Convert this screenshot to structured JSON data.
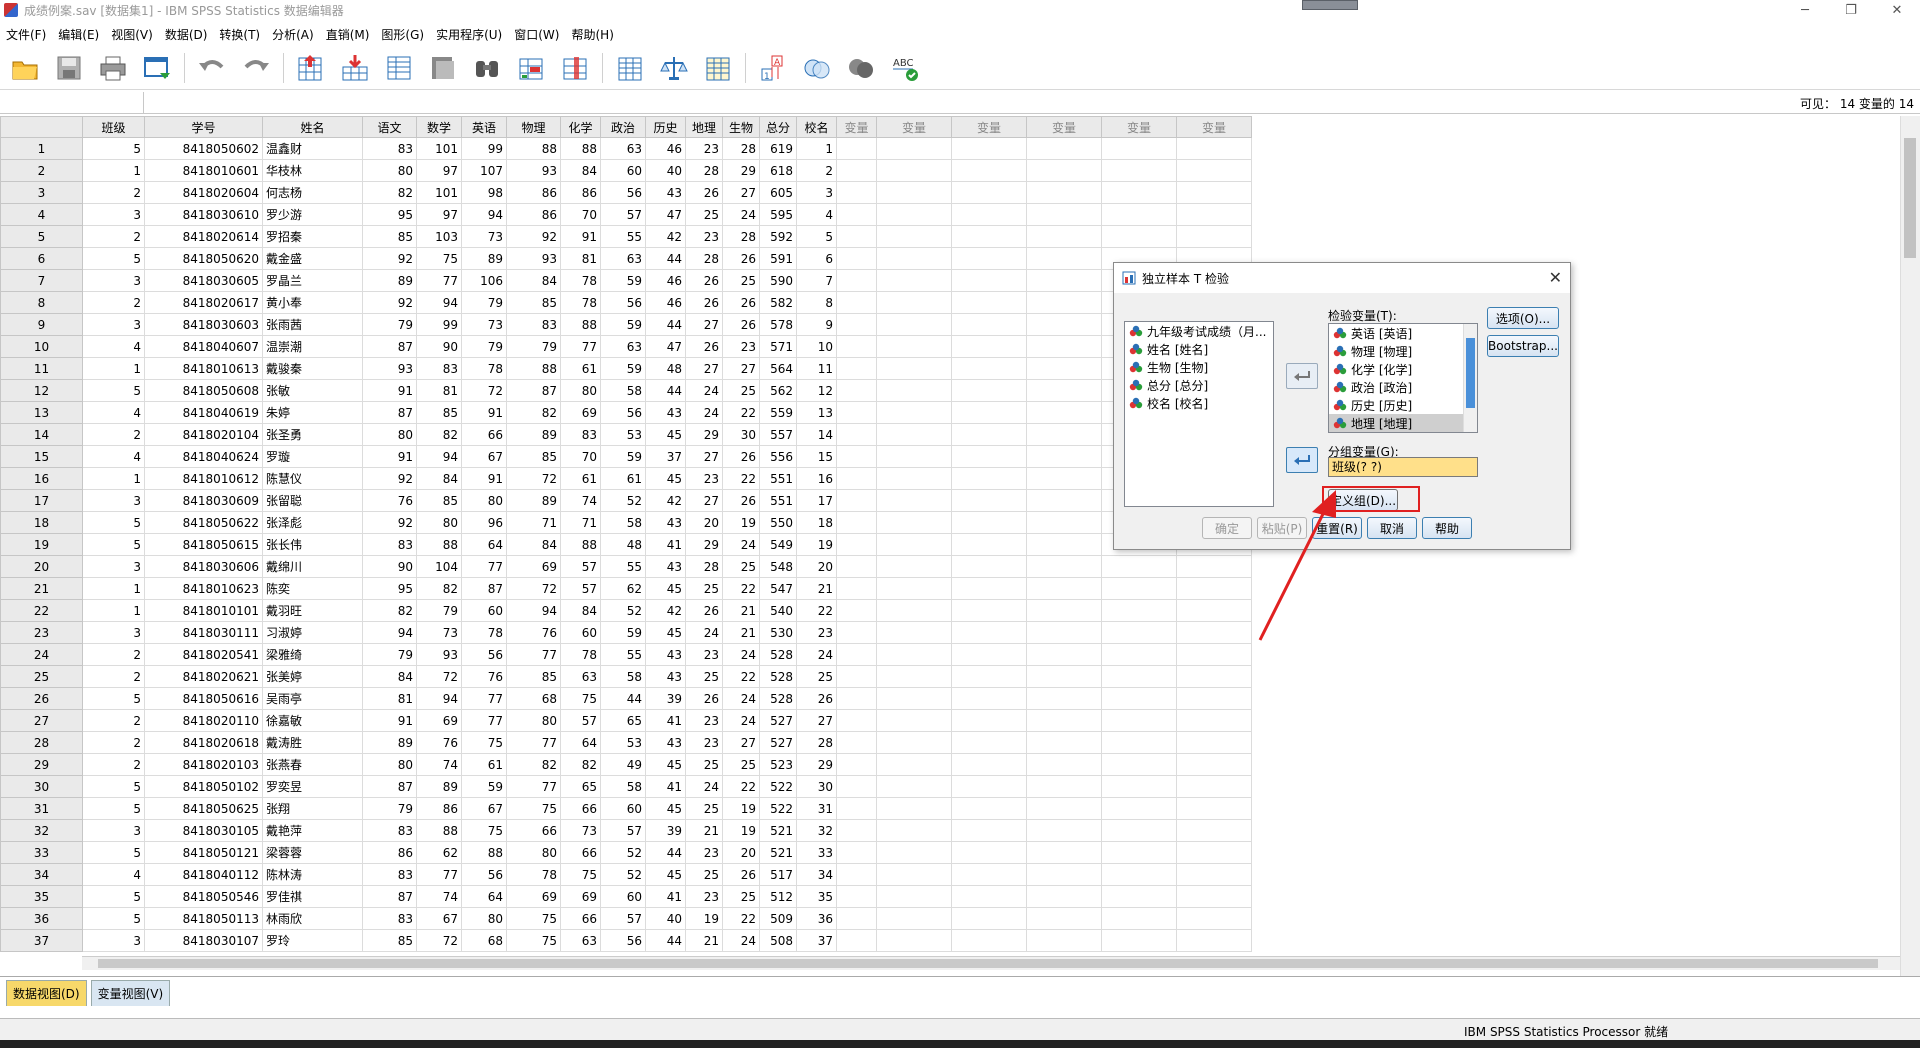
{
  "window": {
    "title": "成绩例案.sav [数据集1] - IBM SPSS Statistics 数据编辑器",
    "controls": [
      "─",
      "❐",
      "✕"
    ]
  },
  "menu": [
    "文件(F)",
    "编辑(E)",
    "视图(V)",
    "数据(D)",
    "转换(T)",
    "分析(A)",
    "直销(M)",
    "图形(G)",
    "实用程序(U)",
    "窗口(W)",
    "帮助(H)"
  ],
  "toolbar_icons": [
    "open-icon",
    "save-icon",
    "print-icon",
    "dialog-recall-icon",
    "undo-icon",
    "redo-icon",
    "goto-case-icon",
    "goto-variable-icon",
    "variables-icon",
    "split-file-icon",
    "find-icon",
    "insert-cases-icon",
    "insert-variable-icon",
    "select-cases-icon",
    "weight-cases-icon",
    "value-labels-icon",
    "use-sets-icon",
    "show-all-icon",
    "spell-check-icon"
  ],
  "visible": "可见：  14 变量的 14",
  "columns": [
    "班级",
    "学号",
    "姓名",
    "语文",
    "数学",
    "英语",
    "物理",
    "化学",
    "政治",
    "历史",
    "地理",
    "生物",
    "总分",
    "校名"
  ],
  "empty_var_label": "变量",
  "rows": [
    [
      "5",
      "8418050602",
      "温鑫财",
      "83",
      "101",
      "99",
      "88",
      "88",
      "63",
      "46",
      "23",
      "28",
      "619",
      "1"
    ],
    [
      "1",
      "8418010601",
      "华枝林",
      "80",
      "97",
      "107",
      "93",
      "84",
      "60",
      "40",
      "28",
      "29",
      "618",
      "2"
    ],
    [
      "2",
      "8418020604",
      "何志杨",
      "82",
      "101",
      "98",
      "86",
      "86",
      "56",
      "43",
      "26",
      "27",
      "605",
      "3"
    ],
    [
      "3",
      "8418030610",
      "罗少游",
      "95",
      "97",
      "94",
      "86",
      "70",
      "57",
      "47",
      "25",
      "24",
      "595",
      "4"
    ],
    [
      "2",
      "8418020614",
      "罗招秦",
      "85",
      "103",
      "73",
      "92",
      "91",
      "55",
      "42",
      "23",
      "28",
      "592",
      "5"
    ],
    [
      "5",
      "8418050620",
      "戴金盛",
      "92",
      "75",
      "89",
      "93",
      "81",
      "63",
      "44",
      "28",
      "26",
      "591",
      "6"
    ],
    [
      "3",
      "8418030605",
      "罗晶兰",
      "89",
      "77",
      "106",
      "84",
      "78",
      "59",
      "46",
      "26",
      "25",
      "590",
      "7"
    ],
    [
      "2",
      "8418020617",
      "黄小奉",
      "92",
      "94",
      "79",
      "85",
      "78",
      "56",
      "46",
      "26",
      "26",
      "582",
      "8"
    ],
    [
      "3",
      "8418030603",
      "张雨茜",
      "79",
      "99",
      "73",
      "83",
      "88",
      "59",
      "44",
      "27",
      "26",
      "578",
      "9"
    ],
    [
      "4",
      "8418040607",
      "温崇潮",
      "87",
      "90",
      "79",
      "79",
      "77",
      "63",
      "47",
      "26",
      "23",
      "571",
      "10"
    ],
    [
      "1",
      "8418010613",
      "戴骏秦",
      "93",
      "83",
      "78",
      "88",
      "61",
      "59",
      "48",
      "27",
      "27",
      "564",
      "11"
    ],
    [
      "5",
      "8418050608",
      "张敏",
      "91",
      "81",
      "72",
      "87",
      "80",
      "58",
      "44",
      "24",
      "25",
      "562",
      "12"
    ],
    [
      "4",
      "8418040619",
      "朱婷",
      "87",
      "85",
      "91",
      "82",
      "69",
      "56",
      "43",
      "24",
      "22",
      "559",
      "13"
    ],
    [
      "2",
      "8418020104",
      "张圣勇",
      "80",
      "82",
      "66",
      "89",
      "83",
      "53",
      "45",
      "29",
      "30",
      "557",
      "14"
    ],
    [
      "4",
      "8418040624",
      "罗璇",
      "91",
      "94",
      "67",
      "85",
      "70",
      "59",
      "37",
      "27",
      "26",
      "556",
      "15"
    ],
    [
      "1",
      "8418010612",
      "陈慧仪",
      "92",
      "84",
      "91",
      "72",
      "61",
      "61",
      "45",
      "23",
      "22",
      "551",
      "16"
    ],
    [
      "3",
      "8418030609",
      "张留聪",
      "76",
      "85",
      "80",
      "89",
      "74",
      "52",
      "42",
      "27",
      "26",
      "551",
      "17"
    ],
    [
      "5",
      "8418050622",
      "张泽彪",
      "92",
      "80",
      "96",
      "71",
      "71",
      "58",
      "43",
      "20",
      "19",
      "550",
      "18"
    ],
    [
      "5",
      "8418050615",
      "张长伟",
      "83",
      "88",
      "64",
      "84",
      "88",
      "48",
      "41",
      "29",
      "24",
      "549",
      "19"
    ],
    [
      "3",
      "8418030606",
      "戴绵川",
      "90",
      "104",
      "77",
      "69",
      "57",
      "55",
      "43",
      "28",
      "25",
      "548",
      "20"
    ],
    [
      "1",
      "8418010623",
      "陈奕",
      "95",
      "82",
      "87",
      "72",
      "57",
      "62",
      "45",
      "25",
      "22",
      "547",
      "21"
    ],
    [
      "1",
      "8418010101",
      "戴羽旺",
      "82",
      "79",
      "60",
      "94",
      "84",
      "52",
      "42",
      "26",
      "21",
      "540",
      "22"
    ],
    [
      "3",
      "8418030111",
      "习淑婷",
      "94",
      "73",
      "78",
      "76",
      "60",
      "59",
      "45",
      "24",
      "21",
      "530",
      "23"
    ],
    [
      "2",
      "8418020541",
      "梁雅绮",
      "79",
      "93",
      "56",
      "77",
      "78",
      "55",
      "43",
      "23",
      "24",
      "528",
      "24"
    ],
    [
      "2",
      "8418020621",
      "张美婷",
      "84",
      "72",
      "76",
      "85",
      "63",
      "58",
      "43",
      "25",
      "22",
      "528",
      "25"
    ],
    [
      "5",
      "8418050616",
      "吴雨亭",
      "81",
      "94",
      "77",
      "68",
      "75",
      "44",
      "39",
      "26",
      "24",
      "528",
      "26"
    ],
    [
      "2",
      "8418020110",
      "徐嘉敏",
      "91",
      "69",
      "77",
      "80",
      "57",
      "65",
      "41",
      "23",
      "24",
      "527",
      "27"
    ],
    [
      "2",
      "8418020618",
      "戴涛胜",
      "89",
      "76",
      "75",
      "77",
      "64",
      "53",
      "43",
      "23",
      "27",
      "527",
      "28"
    ],
    [
      "2",
      "8418020103",
      "张燕春",
      "80",
      "74",
      "61",
      "82",
      "82",
      "49",
      "45",
      "25",
      "25",
      "523",
      "29"
    ],
    [
      "5",
      "8418050102",
      "罗奕昱",
      "87",
      "89",
      "59",
      "77",
      "65",
      "58",
      "41",
      "24",
      "22",
      "522",
      "30"
    ],
    [
      "5",
      "8418050625",
      "张翔",
      "79",
      "86",
      "67",
      "75",
      "66",
      "60",
      "45",
      "25",
      "19",
      "522",
      "31"
    ],
    [
      "3",
      "8418030105",
      "戴艳萍",
      "83",
      "88",
      "75",
      "66",
      "73",
      "57",
      "39",
      "21",
      "19",
      "521",
      "32"
    ],
    [
      "5",
      "8418050121",
      "梁蓉蓉",
      "86",
      "62",
      "88",
      "80",
      "66",
      "52",
      "44",
      "23",
      "20",
      "521",
      "33"
    ],
    [
      "4",
      "8418040112",
      "陈林涛",
      "83",
      "77",
      "56",
      "78",
      "75",
      "52",
      "45",
      "25",
      "26",
      "517",
      "34"
    ],
    [
      "5",
      "8418050546",
      "罗佳祺",
      "87",
      "74",
      "64",
      "69",
      "69",
      "60",
      "41",
      "23",
      "25",
      "512",
      "35"
    ],
    [
      "5",
      "8418050113",
      "林雨欣",
      "83",
      "67",
      "80",
      "75",
      "66",
      "57",
      "40",
      "19",
      "22",
      "509",
      "36"
    ],
    [
      "3",
      "8418030107",
      "罗玲",
      "85",
      "72",
      "68",
      "75",
      "63",
      "56",
      "44",
      "21",
      "24",
      "508",
      "37"
    ]
  ],
  "tabs": {
    "data_view": "数据视图(D)",
    "variable_view": "变量视图(V)"
  },
  "status": "IBM SPSS Statistics Processor 就绪",
  "dialog": {
    "title": "独立样本 T 检验",
    "source_vars": [
      "九年级考试成绩（月...",
      "姓名 [姓名]",
      "生物 [生物]",
      "总分 [总分]",
      "校名 [校名]"
    ],
    "test_label": "检验变量(T):",
    "test_vars": [
      "英语 [英语]",
      "物理 [物理]",
      "化学 [化学]",
      "政治 [政治]",
      "历史 [历史]",
      "地理 [地理]"
    ],
    "group_label": "分组变量(G):",
    "group_value": "班级(? ?)",
    "define_groups": "定义组(D)...",
    "options": "选项(O)...",
    "bootstrap": "Bootstrap...",
    "ok": "确定",
    "paste": "粘贴(P)",
    "reset": "重置(R)",
    "cancel": "取消",
    "help": "帮助",
    "close": "✕"
  }
}
